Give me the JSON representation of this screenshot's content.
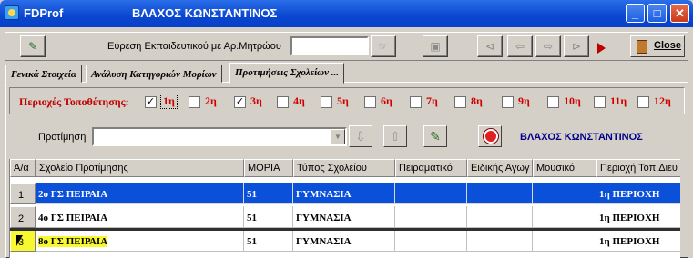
{
  "window": {
    "app_title": "FDProf",
    "title": "ΒΛΑΧΟΣ ΚΩΝΣΤΑΝΤΙΝΟΣ",
    "controls": [
      "_",
      "□",
      "✕"
    ]
  },
  "toolbar": {
    "search_label": "Εύρεση Εκπαιδευτικού με Αρ.Μητρώου",
    "search_value": "",
    "close_label": "Close"
  },
  "tabs": [
    "Γενικά Στοιχεία",
    "Ανάλυση Κατηγοριών Μορίων",
    "Προτιμήσεις Σχολείων ..."
  ],
  "active_tab": 2,
  "regions": {
    "label": "Περιοχές Τοποθέτησης:",
    "items": [
      {
        "label": "1η",
        "checked": true
      },
      {
        "label": "2η",
        "checked": false
      },
      {
        "label": "3η",
        "checked": true
      },
      {
        "label": "4η",
        "checked": false
      },
      {
        "label": "5η",
        "checked": false
      },
      {
        "label": "6η",
        "checked": false
      },
      {
        "label": "7η",
        "checked": false
      },
      {
        "label": "8η",
        "checked": false
      },
      {
        "label": "9η",
        "checked": false
      },
      {
        "label": "10η",
        "checked": false
      },
      {
        "label": "11η",
        "checked": false
      },
      {
        "label": "12η",
        "checked": false
      }
    ]
  },
  "preference": {
    "label": "Προτίμηση",
    "value": "",
    "person_name": "ΒΛΑΧΟΣ ΚΩΝΣΤΑΝΤΙΝΟΣ"
  },
  "grid": {
    "columns": [
      "Α/α",
      "Σχολείο Προτίμησης",
      "ΜΟΡΙΑ",
      "Τύπος Σχολείου",
      "Πειραματικό",
      "Ειδικής Αγωγ",
      "Μουσικό",
      "Περιοχή Τοπ.Διευ"
    ],
    "rows": [
      {
        "num": "1",
        "school": "2ο ΓΣ ΠΕΙΡΑΙΑ",
        "moria": "51",
        "type": "ΓΥΜΝΑΣΙΑ",
        "peir": "",
        "eid": "",
        "mous": "",
        "region": "1η ΠΕΡΙΟΧΗ",
        "selected": true
      },
      {
        "num": "2",
        "school": "4ο ΓΣ ΠΕΙΡΑΙΑ",
        "moria": "51",
        "type": "ΓΥΜΝΑΣΙΑ",
        "peir": "",
        "eid": "",
        "mous": "",
        "region": "1η ΠΕΡΙΟΧΗ",
        "selected": false
      },
      {
        "num": "3",
        "school": "8ο ΓΣ ΠΕΙΡΑΙΑ",
        "moria": "51",
        "type": "ΓΥΜΝΑΣΙΑ",
        "peir": "",
        "eid": "",
        "mous": "",
        "region": "1η ΠΕΡΙΟΧΗ",
        "selected": false
      }
    ]
  },
  "colors": {
    "title_bar": "#0a46d0",
    "selection": "#0a50d8",
    "region_text": "#d00000",
    "highlight": "#f8f830"
  }
}
